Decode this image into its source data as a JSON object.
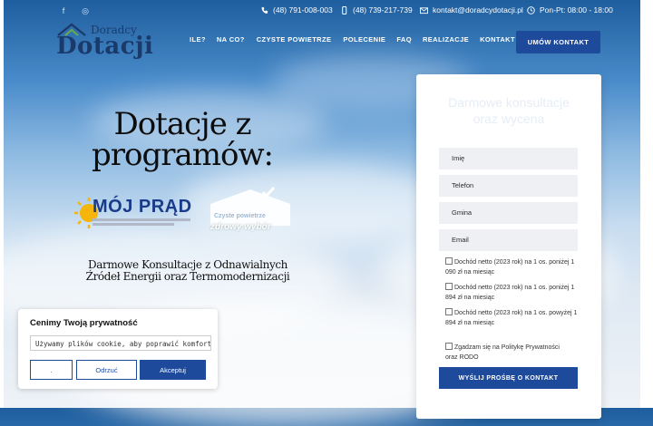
{
  "topbar": {
    "social": [
      {
        "icon": "facebook-icon",
        "glyph": "f"
      },
      {
        "icon": "instagram-icon",
        "glyph": "◎"
      }
    ],
    "phone1": "(48) 791-008-003",
    "phone2": "(48) 739-217-739",
    "email": "kontakt@doradcydotacji.pl",
    "hours": "Pon-Pt: 08:00 - 18:00"
  },
  "logo": {
    "line1": "Doradcy",
    "line2": "Dotacji"
  },
  "nav": {
    "items": [
      "ILE?",
      "NA CO?",
      "CZYSTE POWIETRZE",
      "POLECENIE",
      "FAQ",
      "REALIZACJE",
      "KONTAKT"
    ],
    "cta": "UMÓW KONTAKT"
  },
  "hero": {
    "title": "Dotacje z programów:",
    "subtitle": "Darmowe Konsultacje z Odnawialnych Źródeł Energii oraz Termomodernizacji",
    "program1": "MÓJ PRĄD",
    "program2_line1": "Czyste powietrze",
    "program2_line2": "zdrowy wybór"
  },
  "form": {
    "title": "Darmowe konsultacje oraz wycena",
    "fields": {
      "name": "Imię",
      "phone": "Telefon",
      "commune": "Gmina",
      "email": "Email"
    },
    "checks": [
      "Dochód netto (2023 rok) na 1 os. poniżej 1 090 zł na miesiąc",
      "Dochód netto (2023 rok) na 1 os. poniżej 1 894 zł na miesiąc",
      "Dochód netto (2023 rok) na 1 os. powyżej 1 894 zł na miesiąc",
      "Zgadzam się na Politykę Prywatności oraz RODO"
    ],
    "submit": "WYŚLIJ PROŚBĘ O KONTAKT"
  },
  "cookie": {
    "title": "Cenimy Twoją prywatność",
    "text": "Używamy plików cookie, aby poprawić komfort przeglądania",
    "btn1": ".",
    "btn2": "Odrzuć",
    "btn3": "Akceptuj"
  },
  "colors": {
    "accent": "#1e4a9c",
    "text_dark": "#111111",
    "field_bg": "#eef0f3"
  }
}
